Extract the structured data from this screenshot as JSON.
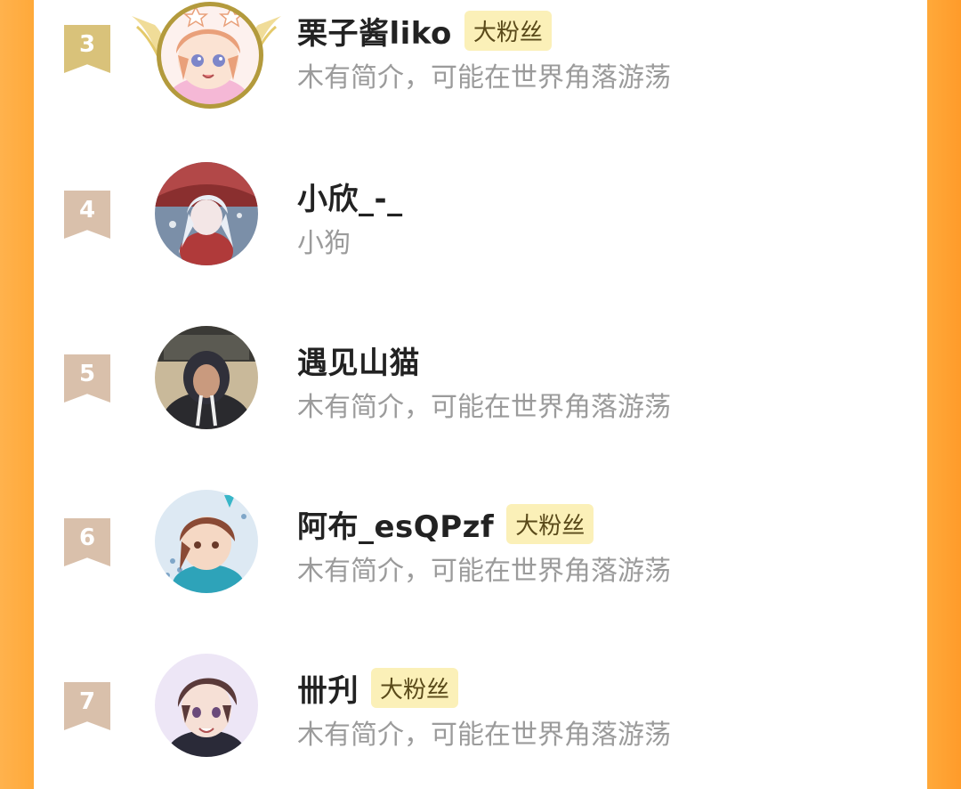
{
  "colors": {
    "side_orange": "#ffa93a",
    "rank_top3": "#d9c27a",
    "rank_default": "#d9c0ab",
    "frame_gold": "#b39a3c",
    "fan_badge_bg": "#fbf0b8",
    "name_text": "#222222",
    "bio_text": "#9b9b9b"
  },
  "fan_badge_label": "大粉丝",
  "fans": [
    {
      "rank": "3",
      "name": "栗子酱liko",
      "fan_badge": true,
      "bio": "木有简介，可能在世界角落游荡",
      "avatar": "anime-girl-avatar",
      "frame": "gold-wing-frame"
    },
    {
      "rank": "4",
      "name": "小欣_-_",
      "fan_badge": false,
      "bio": "小狗",
      "avatar": "snowy-anime-avatar"
    },
    {
      "rank": "5",
      "name": "遇见山猫",
      "fan_badge": false,
      "bio": "木有简介，可能在世界角落游荡",
      "avatar": "hoodie-photo-avatar"
    },
    {
      "rank": "6",
      "name": "阿布_esQPzf",
      "fan_badge": true,
      "bio": "木有简介，可能在世界角落游荡",
      "avatar": "chibi-character-avatar"
    },
    {
      "rank": "7",
      "name": "卌刋",
      "fan_badge": true,
      "bio": "木有简介，可能在世界角落游荡",
      "avatar": "anime-boy-avatar"
    }
  ]
}
